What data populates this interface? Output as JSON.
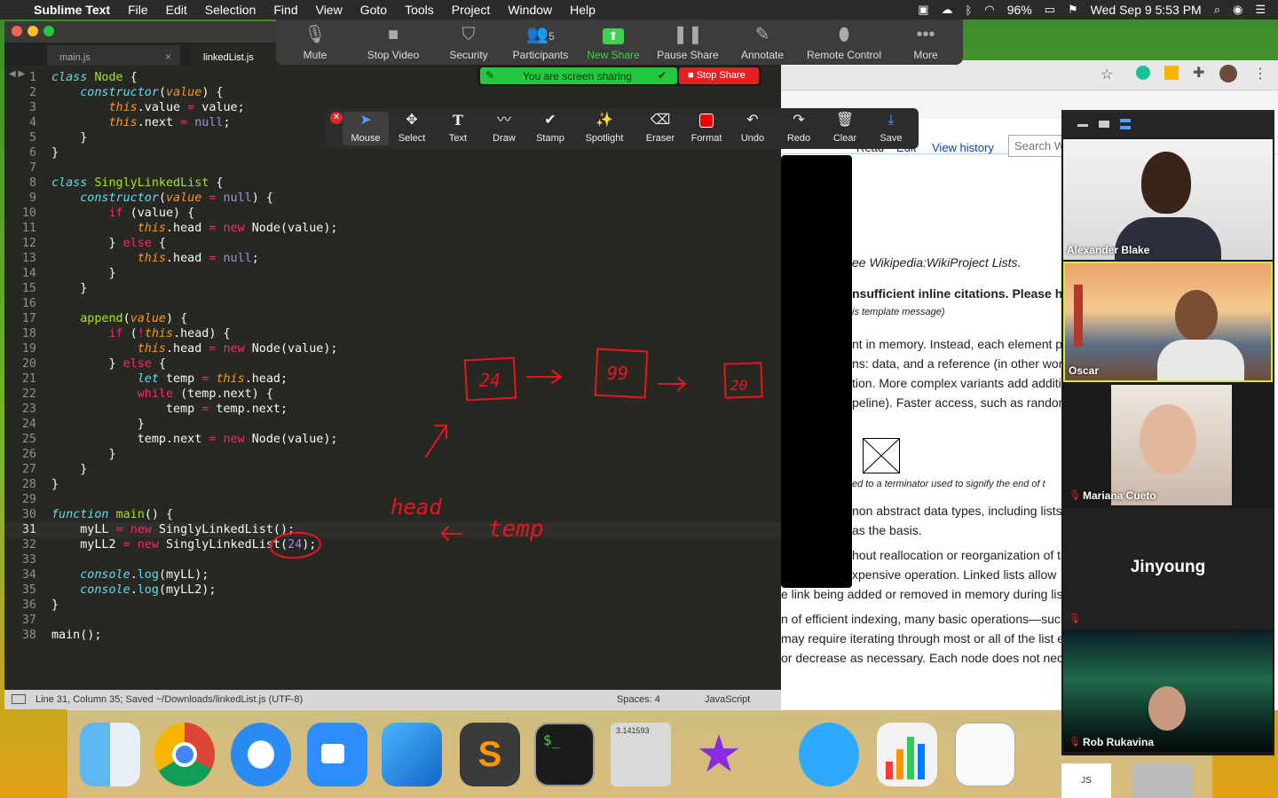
{
  "menubar": {
    "app": "Sublime Text",
    "items": [
      "File",
      "Edit",
      "Selection",
      "Find",
      "View",
      "Goto",
      "Tools",
      "Project",
      "Window",
      "Help"
    ],
    "battery": "96%",
    "clock": "Wed Sep 9  5:53 PM"
  },
  "zoom_toolbar": {
    "buttons": [
      "Mute",
      "Stop Video",
      "Security",
      "Participants",
      "New Share",
      "Pause Share",
      "Annotate",
      "Remote Control",
      "More"
    ],
    "participants_count": "5",
    "sharing_label": "You are screen sharing",
    "stop_share": "Stop Share"
  },
  "annotate_toolbar": {
    "buttons": [
      "Mouse",
      "Select",
      "Text",
      "Draw",
      "Stamp",
      "Spotlight",
      "Eraser",
      "Format",
      "Undo",
      "Redo",
      "Clear",
      "Save"
    ]
  },
  "editor": {
    "tabs": [
      "main.js",
      "linkedList.js"
    ],
    "status_left": "Line 31, Column 35; Saved ~/Downloads/linkedList.js (UTF-8)",
    "status_spaces": "Spaces: 4",
    "status_syntax": "JavaScript"
  },
  "whiteboard": {
    "boxes": [
      "24",
      "99",
      "20"
    ],
    "labels": [
      "head",
      "temp"
    ]
  },
  "wiki": {
    "tabs": [
      "Read",
      "Edit",
      "View history"
    ],
    "search_placeholder": "Search W",
    "lines": [
      "ee Wikipedia:WikiProject Lists.",
      "nsufficient inline citations. Please h",
      "is template message)",
      "nt in memory. Instead, each element p",
      "ns: data, and a reference (in other wor",
      "tion. More complex variants add additi",
      "peline). Faster access, such as random",
      "ed to a terminator used to signify the end of t",
      "non abstract data types, including lists",
      " as the basis.",
      "hout reallocation or reorganization of th",
      "xpensive operation. Linked lists allow",
      "e link being added or removed in memory during lis",
      "n of efficient indexing, many basic operations—such",
      "may require iterating through most or all of the list el",
      "or decrease as necessary. Each node does not nece"
    ]
  },
  "participants": [
    {
      "name": "Alexander Blake"
    },
    {
      "name": "Oscar"
    },
    {
      "name": "Mariana Cueto"
    },
    {
      "name": "Jinyoung"
    },
    {
      "name": "Rob Rukavina"
    }
  ],
  "dock": {
    "calculator_display": "3.141593",
    "doc_label": "JS"
  }
}
